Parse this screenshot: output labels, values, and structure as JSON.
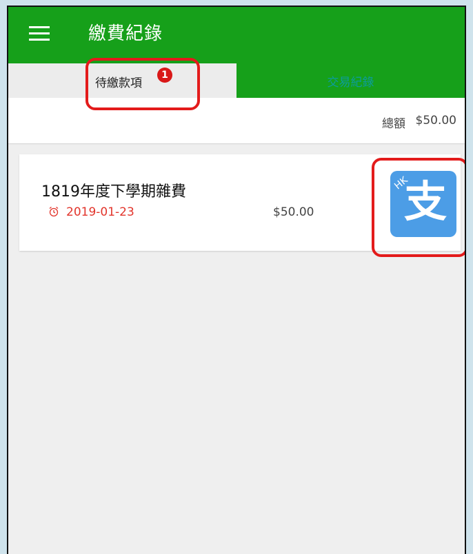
{
  "app_bar": {
    "title": "繳費紀錄",
    "menu_icon": "menu-icon"
  },
  "tabs": [
    {
      "label": "待繳款項",
      "badge": "1",
      "active": true
    },
    {
      "label": "交易紀錄",
      "active": false
    }
  ],
  "summary": {
    "total_label": "總額",
    "total_amount": "$50.00"
  },
  "bill": {
    "title": "1819年度下學期雜費",
    "due_date": "2019-01-23",
    "amount": "$50.00",
    "pay_button": {
      "icon": "alipayhk-icon",
      "logo_text": "支",
      "logo_corner": "HK"
    }
  },
  "colors": {
    "app_bar": "#16a01a",
    "due_date": "#e2342b",
    "badge": "#d91818",
    "callout": "#e31b1b",
    "pay_button_bg": "#4c9de6"
  }
}
